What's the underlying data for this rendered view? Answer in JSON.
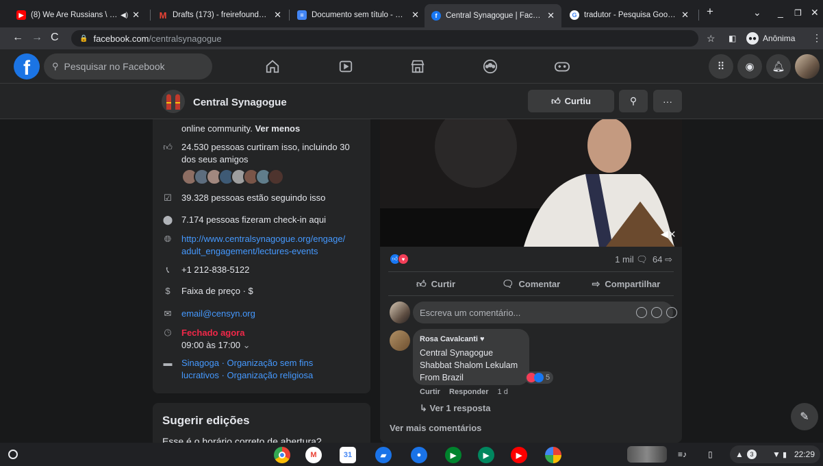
{
  "browser": {
    "tabs": [
      {
        "title": "(8) We Are Russians \\ Mbi",
        "favicon": "youtube-icon",
        "color": "#ff0000"
      },
      {
        "title": "Drafts (173) - freirefoundation",
        "favicon": "gmail-icon",
        "color": "#ea4335"
      },
      {
        "title": "Documento sem título - Docum",
        "favicon": "docs-icon",
        "color": "#4285f4"
      },
      {
        "title": "Central Synagogue | Facebook",
        "favicon": "facebook-icon",
        "color": "#1877f2"
      },
      {
        "title": "tradutor - Pesquisa Google",
        "favicon": "google-icon",
        "color": "#4285f4"
      }
    ],
    "url_host": "facebook.com",
    "url_path": "/centralsynagogue",
    "incognito_label": "Anônima"
  },
  "fb": {
    "search_placeholder": "Pesquisar no Facebook"
  },
  "page": {
    "name": "Central Synagogue",
    "liked_label": "Curtiu"
  },
  "info": {
    "about_tail": "online community.",
    "see_less": "Ver menos",
    "likes": "24.530 pessoas curtiram isso, incluindo 30 dos seus amigos",
    "followers": "39.328 pessoas estão seguindo isso",
    "checkins": "7.174 pessoas fizeram check-in aqui",
    "website_1": "http://www.centralsynagogue.org/engage/",
    "website_2": "adult_engagement/lectures-events",
    "phone": "+1 212-838-5122",
    "price": "Faixa de preço · $",
    "email": "email@censyn.org",
    "hours_status": "Fechado agora",
    "hours": "09:00 às 17:00",
    "cat_1": "Sinagoga",
    "cat_2": "Organização sem fins lucrativos",
    "cat_3": "Organização religiosa"
  },
  "suggest": {
    "title": "Sugerir edições",
    "question": "Esse é o horário correto de abertura?"
  },
  "post": {
    "comments_count": "1 mil",
    "shares_count": "64",
    "like_label": "Curtir",
    "comment_label": "Comentar",
    "share_label": "Compartilhar",
    "comment_placeholder": "Escreva um comentário...",
    "comment": {
      "author": "Rosa Cavalcanti",
      "line1": "Central Synagogue",
      "line2": "Shabbat Shalom Lekulam",
      "line3": "From Brazil",
      "reactions": "5",
      "like": "Curtir",
      "reply": "Responder",
      "time": "1 d"
    },
    "view_replies": "Ver 1 resposta",
    "more_comments": "Ver mais comentários"
  },
  "shelf": {
    "apps": [
      "chrome-icon",
      "gmail-icon",
      "calendar-icon",
      "files-icon",
      "messages-icon",
      "meet-icon",
      "play-store-icon",
      "youtube-icon",
      "photos-icon"
    ],
    "notifications": "3",
    "clock": "22:29"
  }
}
